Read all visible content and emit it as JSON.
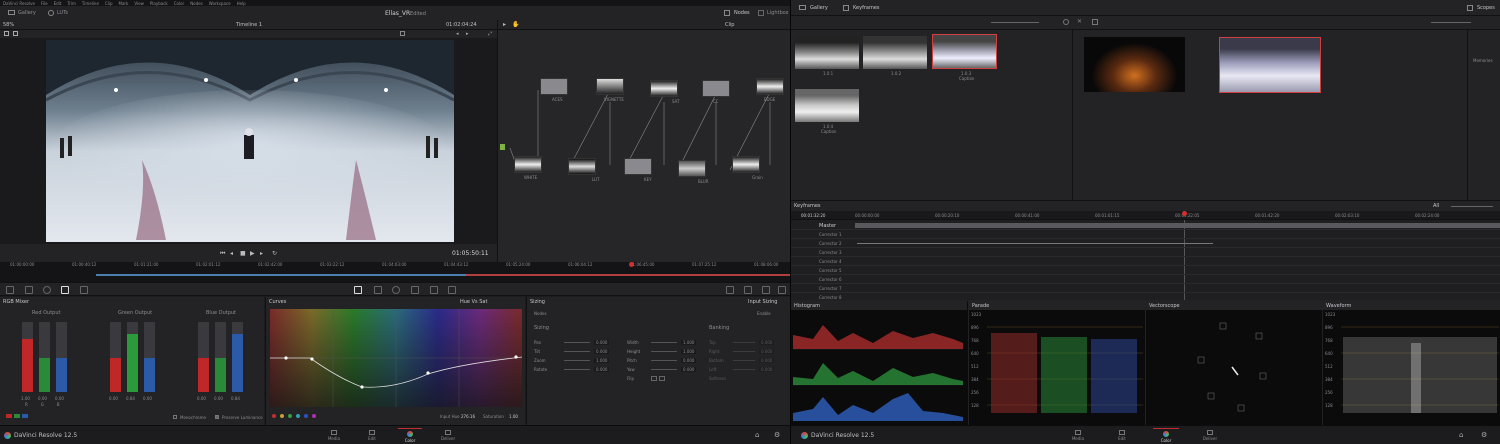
{
  "left": {
    "menu": [
      "DaVinci Resolve",
      "File",
      "Edit",
      "Trim",
      "Timeline",
      "Clip",
      "Mark",
      "View",
      "Playback",
      "Color",
      "Nodes",
      "Workspace",
      "Help"
    ],
    "toolbar": {
      "gallery": "Gallery",
      "luts": "LUTs",
      "project": "Ellas_VR",
      "edited": "Edited",
      "nodes": "Nodes",
      "lightbox": "Lightbox"
    },
    "viewer": {
      "zoom": "58%",
      "timeline_name": "Timeline 1",
      "tc_top": "01:02:04:24",
      "timecode": "01:05:50:11",
      "clip_label": "Clip"
    },
    "ruler_ticks": [
      "01:00:00:00",
      "01:00:40:12",
      "01:01:21:00",
      "01:02:01:12",
      "01:02:42:00",
      "01:03:22:12",
      "01:04:03:00",
      "01:04:43:12",
      "01:05:24:00",
      "01:06:04:12",
      "01:06:45:00",
      "01:07:25:12",
      "01:08:06:00"
    ],
    "nodes": [
      {
        "id": "01",
        "label": "ACES"
      },
      {
        "id": "02",
        "label": "VIGNETTE"
      },
      {
        "id": "03",
        "label": "SAT"
      },
      {
        "id": "04",
        "label": "CC"
      },
      {
        "id": "05",
        "label": "EDGE"
      },
      {
        "id": "06",
        "label": "WHITE"
      },
      {
        "id": "07",
        "label": "LUT"
      },
      {
        "id": "08",
        "label": "KEY"
      },
      {
        "id": "09",
        "label": "BLUR"
      },
      {
        "id": "10",
        "label": "Grain"
      }
    ],
    "rgb_mixer": {
      "title": "RGB Mixer",
      "groups": [
        {
          "name": "Red Output",
          "values": [
            "1.00",
            "0.00",
            "0.00"
          ]
        },
        {
          "name": "Green Output",
          "values": [
            "0.00",
            "0.84",
            "0.00"
          ]
        },
        {
          "name": "Blue Output",
          "values": [
            "0.00",
            "0.00",
            "0.84"
          ]
        }
      ],
      "channels": [
        "R",
        "G",
        "B"
      ],
      "monochrome": "Monochrome",
      "preserve": "Preserve Luminance"
    },
    "curves": {
      "title": "Curves",
      "mode": "Hue Vs Sat",
      "input_hue_label": "Input Hue",
      "input_hue": "276.16",
      "saturation_label": "Saturation",
      "saturation": "1.00"
    },
    "sizing": {
      "title": "Sizing",
      "mode": "Input Sizing",
      "nodes_label": "Nodes",
      "enable_label": "Enable",
      "sizing_label": "Sizing",
      "banking_label": "Banking",
      "left_params": [
        {
          "name": "Pan",
          "value": "0.000"
        },
        {
          "name": "Tilt",
          "value": "0.000"
        },
        {
          "name": "Zoom",
          "value": "1.000"
        },
        {
          "name": "Rotate",
          "value": "0.000"
        }
      ],
      "mid_params": [
        {
          "name": "Width",
          "value": "1.000"
        },
        {
          "name": "Height",
          "value": "1.000"
        },
        {
          "name": "Pitch",
          "value": "0.000"
        },
        {
          "name": "Yaw",
          "value": "0.000"
        }
      ],
      "flip_label": "Flip",
      "right_params": [
        "Top",
        "Right",
        "Bottom",
        "Left",
        "Softness"
      ],
      "right_value": "0.000"
    },
    "pages": [
      {
        "name": "Media"
      },
      {
        "name": "Edit"
      },
      {
        "name": "Color"
      },
      {
        "name": "Deliver"
      }
    ],
    "app_name": "DaVinci Resolve 12.5"
  },
  "right": {
    "toolbar": {
      "gallery": "Gallery",
      "keyframes": "Keyframes",
      "scopes": "Scopes"
    },
    "stills": [
      {
        "label": "1.0.1"
      },
      {
        "label": "1.0.2"
      },
      {
        "label": "1.0.3",
        "sub": "Caption"
      },
      {
        "label": "1.0.4",
        "sub": "Caption"
      }
    ],
    "memories_label": "Memories",
    "keyframes": {
      "title": "Keyframes",
      "filter": "All",
      "tc": "00:01:32:20",
      "ticks": [
        "00:00:00:00",
        "00:00:20:10",
        "00:00:41:00",
        "00:01:01:15",
        "00:01:22:05",
        "00:01:42:20",
        "00:02:03:10",
        "00:02:24:00"
      ],
      "rows": [
        {
          "label": "Master"
        },
        {
          "label": "Corrector 1"
        },
        {
          "label": "Corrector 2"
        },
        {
          "label": "Corrector 3"
        },
        {
          "label": "Corrector 4"
        },
        {
          "label": "Corrector 5"
        },
        {
          "label": "Corrector 6"
        },
        {
          "label": "Corrector 7"
        },
        {
          "label": "Corrector 8"
        }
      ]
    },
    "scopes": [
      {
        "name": "Histogram"
      },
      {
        "name": "Parade",
        "scale": [
          "1023",
          "896",
          "768",
          "640",
          "512",
          "384",
          "256",
          "128"
        ]
      },
      {
        "name": "Vectorscope"
      },
      {
        "name": "Waveform",
        "scale": [
          "1023",
          "896",
          "768",
          "640",
          "512",
          "384",
          "256",
          "128"
        ]
      }
    ],
    "pages": [
      {
        "name": "Media"
      },
      {
        "name": "Edit"
      },
      {
        "name": "Color"
      },
      {
        "name": "Deliver"
      }
    ],
    "app_name": "DaVinci Resolve 12.5"
  }
}
